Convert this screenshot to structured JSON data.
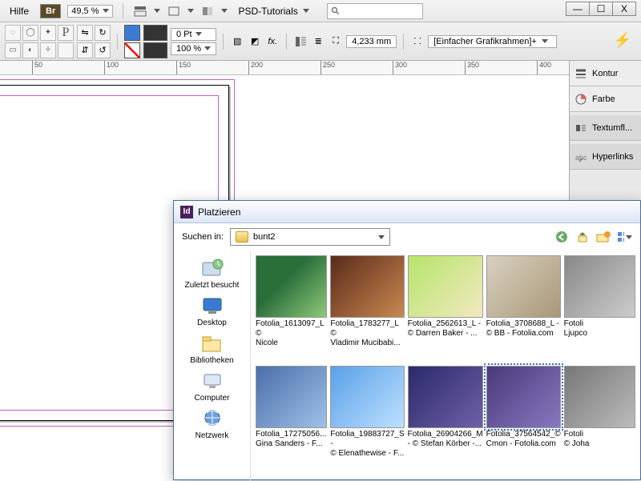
{
  "menubar": {
    "help": "Hilfe",
    "bridge_badge": "Br",
    "zoom": "49,5 %",
    "doc_label": "PSD-Tutorials"
  },
  "win": {
    "min": "—",
    "max": "☐",
    "close": "X"
  },
  "controlbar": {
    "stroke_pt": "0 Pt",
    "opacity": "100 %",
    "measure": "4,233 mm",
    "frame_label": "[Einfacher Grafikrahmen]+"
  },
  "ruler": {
    "ticks": [
      "50",
      "100",
      "150",
      "200",
      "250",
      "300",
      "350",
      "400"
    ]
  },
  "panels": {
    "kontur": "Kontur",
    "farbe": "Farbe",
    "textumfluss": "Textumfl...",
    "hyperlinks": "Hyperlinks"
  },
  "dialog": {
    "title": "Platzieren",
    "search_label": "Suchen in:",
    "folder": "bunt2",
    "places": {
      "recent": "Zuletzt besucht",
      "desktop": "Desktop",
      "libraries": "Bibliotheken",
      "computer": "Computer",
      "network": "Netzwerk"
    },
    "files": [
      {
        "line1": "Fotolia_1613097_L ©",
        "line2": "Nicole Steinbichler..."
      },
      {
        "line1": "Fotolia_1783277_L ©",
        "line2": "Vladimir Mucibabi..."
      },
      {
        "line1": "Fotolia_2562613_L -",
        "line2": "© Darren Baker - ..."
      },
      {
        "line1": "Fotolia_3708688_L -",
        "line2": "© BB - Fotolia.com"
      },
      {
        "line1": "Fotoli",
        "line2": "Ljupco"
      },
      {
        "line1": "Fotolia_17275056...",
        "line2": "Gina Sanders - F..."
      },
      {
        "line1": "Fotolia_19883727_S -",
        "line2": "© Elenathewise - F..."
      },
      {
        "line1": "Fotolia_26904266_M",
        "line2": "- © Stefan Körber -..."
      },
      {
        "line1": "Fotolia_37564542_©",
        "line2": "Cmon - Fotolia.com"
      },
      {
        "line1": "Fotoli",
        "line2": "© Joha"
      }
    ]
  }
}
